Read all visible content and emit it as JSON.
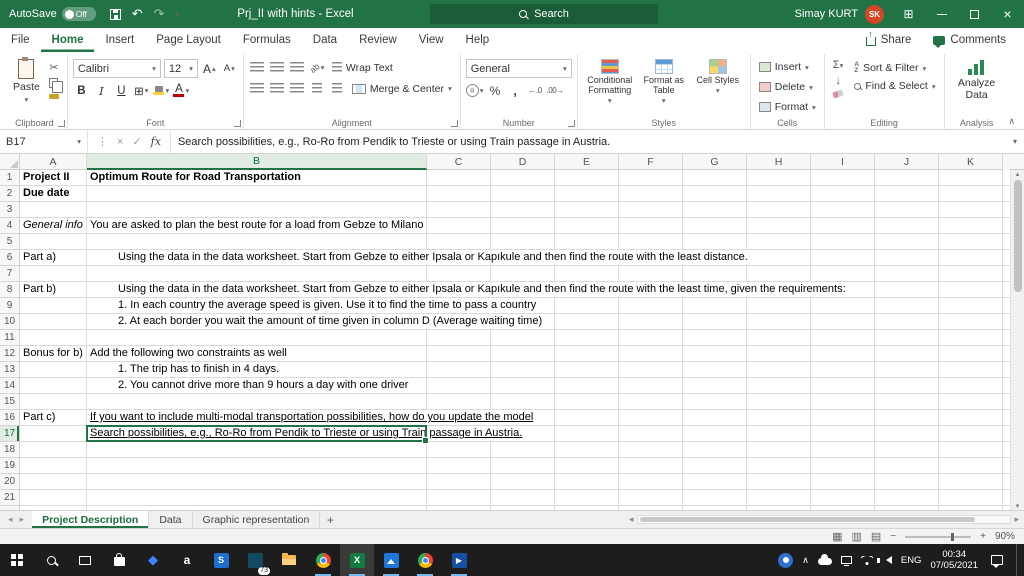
{
  "titlebar": {
    "autosave_label": "AutoSave",
    "autosave_state": "Off",
    "title": "Prj_II with hints - Excel",
    "search_placeholder": "Search",
    "user_name": "Simay KURT",
    "user_initials": "SK"
  },
  "menubar": {
    "tabs": [
      "File",
      "Home",
      "Insert",
      "Page Layout",
      "Formulas",
      "Data",
      "Review",
      "View",
      "Help"
    ],
    "active_tab": "Home",
    "share": "Share",
    "comments": "Comments"
  },
  "ribbon": {
    "clipboard": {
      "paste": "Paste",
      "group": "Clipboard"
    },
    "font": {
      "name": "Calibri",
      "size": "12",
      "bold": "B",
      "italic": "I",
      "underline": "U",
      "group": "Font"
    },
    "alignment": {
      "wrap": "Wrap Text",
      "merge": "Merge & Center",
      "group": "Alignment"
    },
    "number": {
      "format": "General",
      "group": "Number"
    },
    "styles": {
      "conditional": "Conditional Formatting",
      "table": "Format as Table",
      "cell": "Cell Styles",
      "group": "Styles"
    },
    "cells": {
      "insert": "Insert",
      "delete": "Delete",
      "format": "Format",
      "group": "Cells"
    },
    "editing": {
      "sort": "Sort & Filter",
      "find": "Find & Select",
      "group": "Editing"
    },
    "analysis": {
      "analyze": "Analyze Data",
      "group": "Analysis"
    }
  },
  "formula_bar": {
    "cell_ref": "B17",
    "fx": "fx",
    "content": "Search possibilities, e.g., Ro-Ro from Pendik to Trieste or using Train passage in Austria."
  },
  "grid": {
    "columns": [
      "A",
      "B",
      "C",
      "D",
      "E",
      "F",
      "G",
      "H",
      "I",
      "J",
      "K"
    ],
    "row_count": 21,
    "selected_cell": "B17",
    "cells": [
      {
        "row": 1,
        "col": "A",
        "text": "Project II",
        "bold": true
      },
      {
        "row": 1,
        "col": "B",
        "text": "Optimum Route for Road Transportation",
        "bold": true
      },
      {
        "row": 2,
        "col": "A",
        "text": "Due date",
        "bold": true
      },
      {
        "row": 4,
        "col": "A",
        "text": "General info",
        "italic": true
      },
      {
        "row": 4,
        "col": "B",
        "text": "You are asked to plan the best route for a load from Gebze to Milano"
      },
      {
        "row": 6,
        "col": "A",
        "text": "Part a)"
      },
      {
        "row": 6,
        "col": "B",
        "text": "Using the data in the data worksheet. Start from Gebze to either Ipsala or Kapıkule and then find the route with the least distance.",
        "indent": 1
      },
      {
        "row": 8,
        "col": "A",
        "text": "Part b)"
      },
      {
        "row": 8,
        "col": "B",
        "text": "Using the data in the data worksheet. Start from Gebze to either Ipsala or Kapıkule and then find the route with the least time, given the requirements:",
        "indent": 1
      },
      {
        "row": 9,
        "col": "B",
        "text": "1. In each country the average speed is given. Use it to find the time to pass a country",
        "indent": 1
      },
      {
        "row": 10,
        "col": "B",
        "text": "2. At each border you wait the amount of time given in column D (Average waiting time)",
        "indent": 1
      },
      {
        "row": 12,
        "col": "A",
        "text": "Bonus for b)"
      },
      {
        "row": 12,
        "col": "B",
        "text": "Add the following two constraints as well"
      },
      {
        "row": 13,
        "col": "B",
        "text": "1. The trip has to finish in 4 days.",
        "indent": 1
      },
      {
        "row": 14,
        "col": "B",
        "text": "2. You cannot drive more than 9 hours a day with one driver",
        "indent": 1
      },
      {
        "row": 16,
        "col": "A",
        "text": "Part c)"
      },
      {
        "row": 16,
        "col": "B",
        "text": "If you want to include multi-modal transportation possibilities, how do you update the model",
        "underline": true
      },
      {
        "row": 17,
        "col": "B",
        "text": "Search possibilities, e.g., Ro-Ro from Pendik to Trieste or using Train passage in Austria.",
        "underline": true
      }
    ]
  },
  "sheet_tabs": {
    "tabs": [
      {
        "label": "Project Description",
        "active": true
      },
      {
        "label": "Data",
        "active": false
      },
      {
        "label": "Graphic representation",
        "active": false
      }
    ],
    "add": "+"
  },
  "status_bar": {
    "zoom": "90%",
    "zoom_out": "−",
    "zoom_in": "+"
  },
  "taskbar": {
    "language": "ENG",
    "time": "00:34",
    "date": "07/05/2021",
    "badge": "73"
  },
  "icons": {
    "dropdown": "▾",
    "up_small": "▴",
    "sigma": "Σ",
    "scissors": "✂",
    "dots": "⋮",
    "cancel": "×",
    "enter": "✓",
    "undo": "↶",
    "redo": "↷",
    "collapse": "∧",
    "borders": "⊞",
    "ribbon_options": "⊞",
    "percent": "%",
    "comma": ",",
    "currency": "¤",
    "inc_decimal": "←.0",
    "dec_decimal": ".00→",
    "fill_down": "↓",
    "sort_a": "A",
    "sort_z": "Z",
    "sort_arrow": "↓",
    "wrap_ab": "ab",
    "orient_ab": "ab",
    "a_large": "A",
    "a_small": "A",
    "view_normal": "▦",
    "view_page": "▥",
    "view_break": "▤",
    "nav_left": "◂",
    "nav_right": "▸",
    "scroll_up": "▴",
    "scroll_down": "▾",
    "play": "▶",
    "diamond": "◆",
    "letter_a": "a",
    "letter_s": "S",
    "letter_x": "X"
  }
}
